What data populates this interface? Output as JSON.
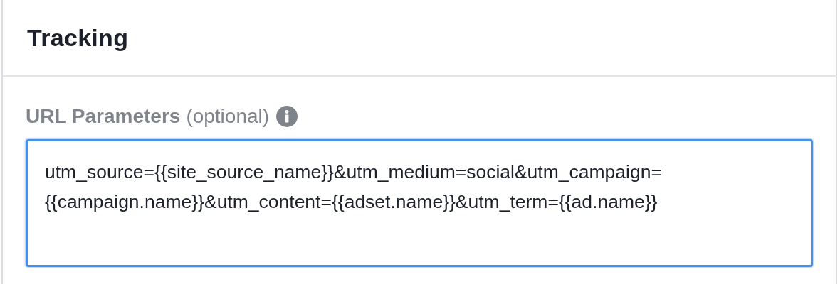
{
  "section": {
    "title": "Tracking"
  },
  "field": {
    "label": "URL Parameters",
    "hint": "(optional)",
    "focused": true,
    "value_lines": [
      "utm_source={{site_source_name}}&utm_medium=social&utm_campaign=",
      "{{campaign.name}}&utm_content={{adset.name}}&utm_term={{ad.name}}"
    ]
  }
}
